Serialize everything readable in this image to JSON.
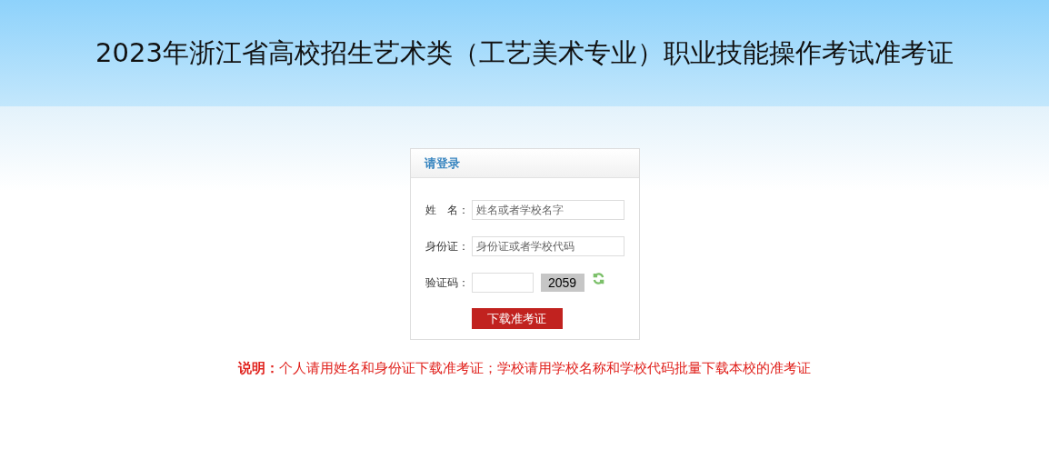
{
  "header": {
    "title": "2023年浙江省高校招生艺术类（工艺美术专业）职业技能操作考试准考证"
  },
  "login": {
    "title": "请登录",
    "fields": [
      {
        "kind": "text",
        "label": "姓　名：",
        "placeholder": "姓名或者学校名字"
      },
      {
        "kind": "text",
        "label": "身份证：",
        "placeholder": "身份证或者学校代码"
      },
      {
        "kind": "captcha",
        "label": "验证码：",
        "captcha": "2059"
      }
    ],
    "submit": "下载准考证"
  },
  "note": {
    "label": "说明：",
    "text": "个人请用姓名和身份证下载准考证；学校请用学校名称和学校代码批量下载本校的准考证"
  }
}
